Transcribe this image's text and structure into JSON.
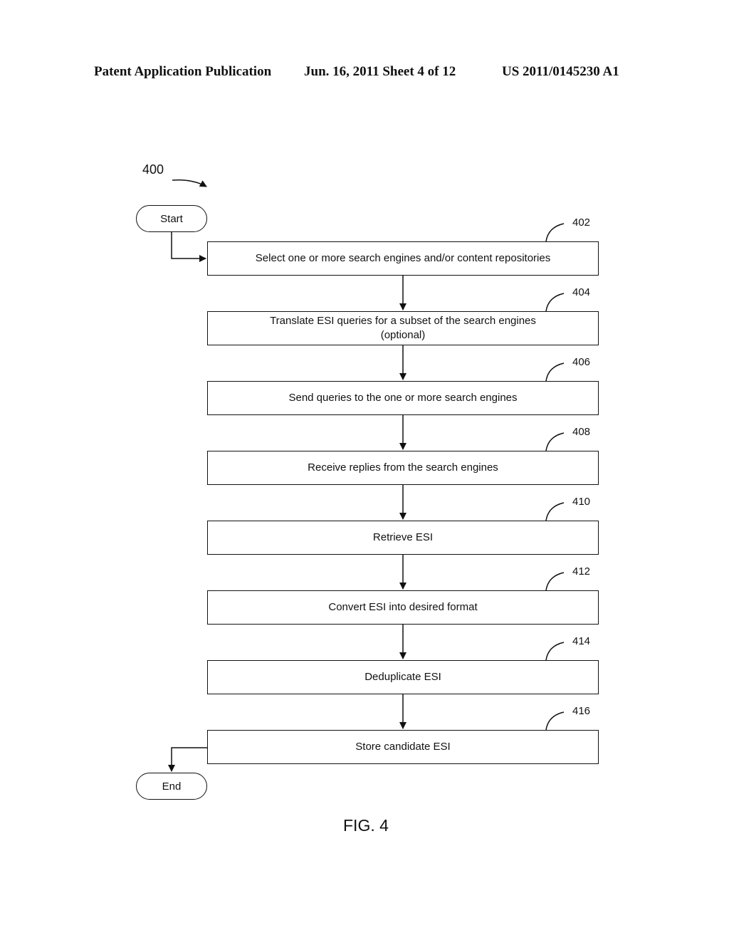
{
  "header": {
    "left": "Patent Application Publication",
    "middle": "Jun. 16, 2011  Sheet 4 of 12",
    "right": "US 2011/0145230 A1"
  },
  "figure": {
    "number_label": "400",
    "caption": "FIG. 4",
    "start_label": "Start",
    "end_label": "End",
    "steps": [
      {
        "ref": "402",
        "text": "Select one or more search engines and/or content repositories"
      },
      {
        "ref": "404",
        "text": "Translate ESI queries for a subset of the search engines\n(optional)"
      },
      {
        "ref": "406",
        "text": "Send queries to the one or more search engines"
      },
      {
        "ref": "408",
        "text": "Receive replies from the search engines"
      },
      {
        "ref": "410",
        "text": "Retrieve ESI"
      },
      {
        "ref": "412",
        "text": "Convert ESI into desired format"
      },
      {
        "ref": "414",
        "text": "Deduplicate ESI"
      },
      {
        "ref": "416",
        "text": "Store candidate ESI"
      }
    ]
  }
}
